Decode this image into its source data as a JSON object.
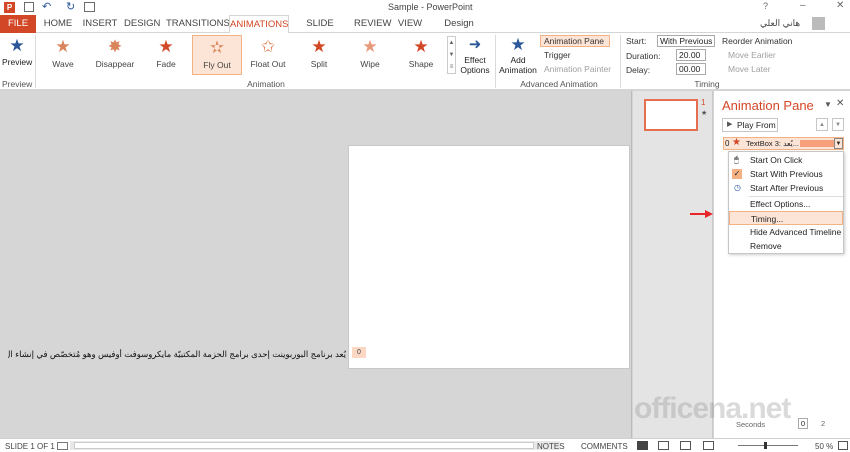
{
  "titlebar": {
    "title": "Sample - PowerPoint",
    "user": "هاني العلي"
  },
  "tabs": [
    "FILE",
    "HOME",
    "INSERT",
    "DESIGN",
    "TRANSITIONS",
    "ANIMATIONS",
    "SLIDE SHOW",
    "REVIEW",
    "VIEW",
    "Design Tools"
  ],
  "ribbon": {
    "preview": {
      "label": "Preview",
      "group": "Preview"
    },
    "effects": [
      "Wave",
      "Disappear",
      "Fade",
      "Fly Out",
      "Float Out",
      "Split",
      "Wipe",
      "Shape"
    ],
    "effect_options": "Effect Options",
    "animation_group": "Animation",
    "add_animation": "Add Animation",
    "animation_pane": "Animation Pane",
    "trigger": "Trigger",
    "animation_painter": "Animation Painter",
    "advanced_group": "Advanced Animation",
    "start_label": "Start:",
    "start_value": "With Previous",
    "duration_label": "Duration:",
    "duration_value": "20.00",
    "delay_label": "Delay:",
    "delay_value": "00.00",
    "reorder": "Reorder Animation",
    "move_earlier": "Move Earlier",
    "move_later": "Move Later",
    "timing_group": "Timing"
  },
  "slide": {
    "text": "يُعد برنامج البوربوينت إحدى برامج الحزمة المكتبيّة مايكروسوفت أوفيس وهو مُتخصّص في إنشاء ال",
    "tag": "0"
  },
  "thumbs": {
    "number": "1",
    "star": "★"
  },
  "pane": {
    "title": "Animation Pane",
    "play_from": "Play From",
    "item_index": "0",
    "item_label": "TextBox 3: يُعد...",
    "menu": [
      "Start On Click",
      "Start With Previous",
      "Start After Previous",
      "Effect Options...",
      "Timing...",
      "Hide Advanced Timeline",
      "Remove"
    ],
    "seconds_label": "Seconds",
    "sec0": "0",
    "sec2": "2"
  },
  "status": {
    "slide": "SLIDE 1 OF 1",
    "notes": "NOTES",
    "comments": "COMMENTS",
    "zoom": "50 %"
  },
  "watermark": "officena.net",
  "colors": {
    "accent": "#d24726"
  }
}
